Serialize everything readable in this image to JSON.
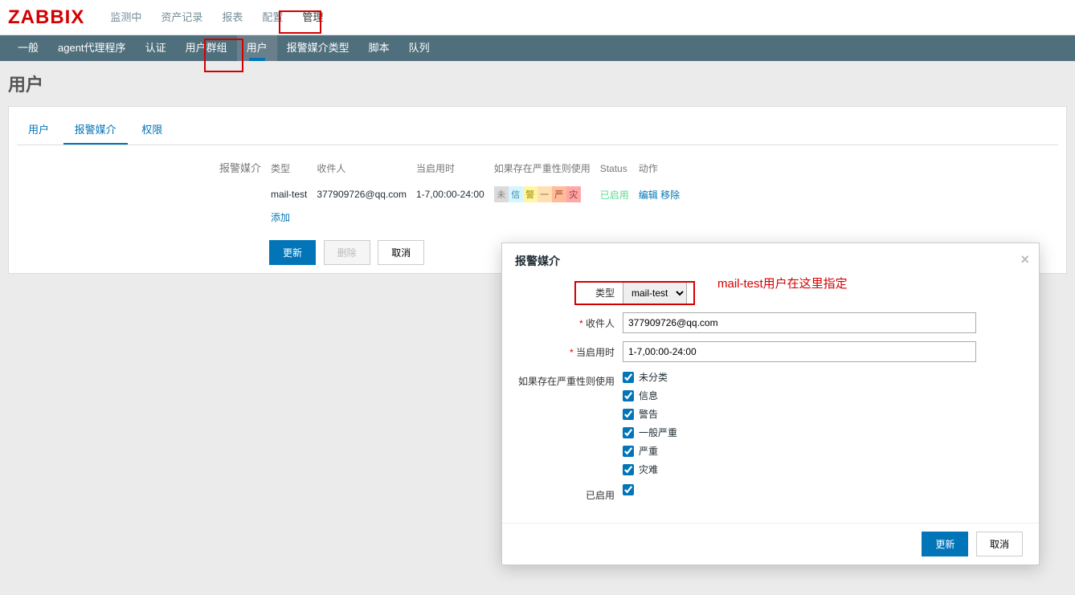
{
  "logo": "ZABBIX",
  "topNav": {
    "items": [
      {
        "label": "监测中"
      },
      {
        "label": "资产记录"
      },
      {
        "label": "报表"
      },
      {
        "label": "配置"
      },
      {
        "label": "管理",
        "selected": true
      }
    ]
  },
  "subNav": {
    "items": [
      {
        "label": "一般"
      },
      {
        "label": "agent代理程序"
      },
      {
        "label": "认证"
      },
      {
        "label": "用户群组"
      },
      {
        "label": "用户",
        "selected": true
      },
      {
        "label": "报警媒介类型"
      },
      {
        "label": "脚本"
      },
      {
        "label": "队列"
      }
    ]
  },
  "pageTitle": "用户",
  "contentTabs": {
    "items": [
      {
        "label": "用户"
      },
      {
        "label": "报警媒介",
        "active": true
      },
      {
        "label": "权限"
      }
    ]
  },
  "media": {
    "sectionLabel": "报警媒介",
    "headers": {
      "type": "类型",
      "recipient": "收件人",
      "whenActive": "当启用时",
      "useIfSeverity": "如果存在严重性则使用",
      "status": "Status",
      "action": "动作"
    },
    "row": {
      "type": "mail-test",
      "recipient": "377909726@qq.com",
      "whenActive": "1-7,00:00-24:00",
      "status": "已启用",
      "edit": "编辑",
      "remove": "移除"
    },
    "severities": {
      "s0": "未",
      "s1": "信",
      "s2": "警",
      "s3": "一",
      "s4": "严",
      "s5": "灾"
    },
    "addLink": "添加"
  },
  "buttons": {
    "update": "更新",
    "delete": "删除",
    "cancel": "取消"
  },
  "modal": {
    "title": "报警媒介",
    "labels": {
      "type": "类型",
      "recipient": "收件人",
      "whenActive": "当启用时",
      "useIfSeverity": "如果存在严重性则使用",
      "enabled": "已启用"
    },
    "values": {
      "type": "mail-test",
      "recipient": "377909726@qq.com",
      "whenActive": "1-7,00:00-24:00"
    },
    "severityOptions": [
      {
        "label": "未分类",
        "checked": true
      },
      {
        "label": "信息",
        "checked": true
      },
      {
        "label": "警告",
        "checked": true
      },
      {
        "label": "一般严重",
        "checked": true
      },
      {
        "label": "严重",
        "checked": true
      },
      {
        "label": "灾难",
        "checked": true
      }
    ],
    "enabledChecked": true,
    "buttons": {
      "update": "更新",
      "cancel": "取消"
    }
  },
  "annotation": "mail-test用户在这里指定"
}
